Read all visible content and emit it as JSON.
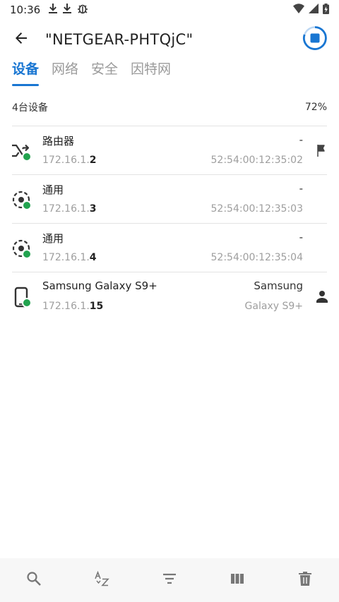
{
  "status_bar": {
    "time": "10:36",
    "left_icons": [
      "download-icon",
      "download-icon",
      "bug-icon"
    ],
    "right_icons": [
      "wifi-icon",
      "signal-icon",
      "battery-icon"
    ]
  },
  "app_bar": {
    "title": "\"NETGEAR-PHTQjC\"",
    "back_icon": "arrow-back-icon",
    "action_icon": "stop-scan-icon"
  },
  "tabs": [
    {
      "label": "设备",
      "active": true
    },
    {
      "label": "网络",
      "active": false
    },
    {
      "label": "安全",
      "active": false
    },
    {
      "label": "因特网",
      "active": false
    }
  ],
  "summary": {
    "count_label": "4台设备",
    "percent": "72%"
  },
  "devices": [
    {
      "icon": "router-shuffle-icon",
      "name": "路由器",
      "ip_prefix": "172.16.1.",
      "ip_suffix": "2",
      "vendor": "-",
      "mac": "52:54:00:12:35:02",
      "side_icon": "flag-icon",
      "online": true
    },
    {
      "icon": "generic-device-icon",
      "name": "通用",
      "ip_prefix": "172.16.1.",
      "ip_suffix": "3",
      "vendor": "-",
      "mac": "52:54:00:12:35:03",
      "side_icon": "",
      "online": true
    },
    {
      "icon": "generic-device-icon",
      "name": "通用",
      "ip_prefix": "172.16.1.",
      "ip_suffix": "4",
      "vendor": "-",
      "mac": "52:54:00:12:35:04",
      "side_icon": "",
      "online": true
    },
    {
      "icon": "phone-icon",
      "name": "Samsung Galaxy S9+",
      "ip_prefix": "172.16.1.",
      "ip_suffix": "15",
      "vendor": "Samsung",
      "mac": "Galaxy S9+",
      "side_icon": "person-icon",
      "online": true
    }
  ],
  "bottom_bar": [
    "search-icon",
    "sort-az-icon",
    "filter-icon",
    "columns-icon",
    "delete-icon"
  ],
  "colors": {
    "accent": "#1976d2",
    "online": "#22a34f",
    "secondary_text": "#9e9e9e"
  }
}
